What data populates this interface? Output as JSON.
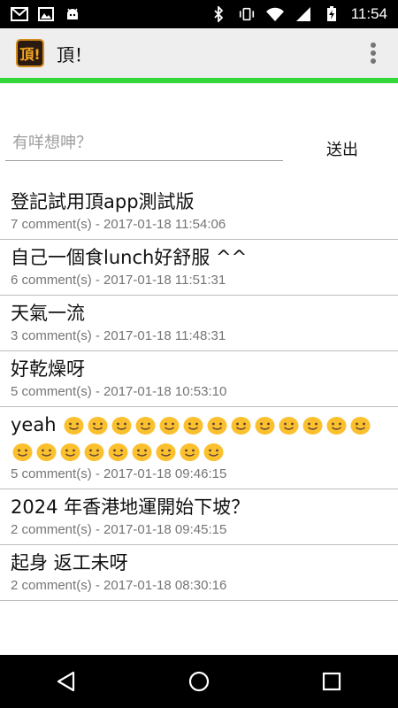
{
  "status_bar": {
    "time": "11:54",
    "left_icons": [
      "gmail-icon",
      "image-icon",
      "android-icon"
    ],
    "right_icons": [
      "bluetooth-icon",
      "vibrate-icon",
      "wifi-icon",
      "signal-icon",
      "battery-charging-icon"
    ]
  },
  "app_bar": {
    "logo_text": "頂!",
    "title": "頂！",
    "overflow_icon": "more-vert-icon"
  },
  "composer": {
    "placeholder": "有咩想呻？",
    "send_label": "送出"
  },
  "posts": [
    {
      "title": "登記試用頂app測試版",
      "meta": "7 comment(s)  -  2017-01-18 11:54:06"
    },
    {
      "title": "自己一個食lunch好舒服 ^^",
      "meta": "6 comment(s)  -  2017-01-18 11:51:31"
    },
    {
      "title": "天氣一流",
      "meta": "3 comment(s)  -  2017-01-18 11:48:31"
    },
    {
      "title": "好乾燥呀",
      "meta": "5 comment(s)  -  2017-01-18 10:53:10"
    },
    {
      "title": "yeah",
      "meta": "5 comment(s)  -  2017-01-18 09:46:15",
      "emoji_count": 22
    },
    {
      "title": "2024 年香港地運開始下坡？",
      "meta": "2 comment(s)  -  2017-01-18 09:45:15"
    },
    {
      "title": "起身 返工未呀",
      "meta": "2 comment(s)  -  2017-01-18 08:30:16"
    }
  ],
  "nav_bar": {
    "icons": [
      "back-icon",
      "home-icon",
      "recents-icon"
    ]
  },
  "colors": {
    "accent_line": "#35d83a",
    "app_bar_bg": "#eeeeee",
    "meta_text": "#757575",
    "emoji_yellow": "#fbc02d"
  }
}
